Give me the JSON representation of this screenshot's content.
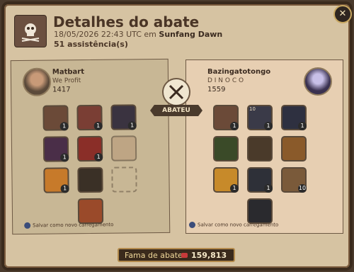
{
  "header": {
    "title": "Detalhes do abate",
    "datetime": "18/05/2026 22:43 UTC em",
    "zone": "Sunfang Dawn",
    "assists_count": "51",
    "assists_label": "assistência(s)"
  },
  "killer": {
    "name": "Matbart",
    "guild": "We Profit",
    "item_power": "1417",
    "slots": [
      {
        "slot": "bag",
        "quality": "1",
        "level": ""
      },
      {
        "slot": "head",
        "quality": "1",
        "level": ""
      },
      {
        "slot": "cape",
        "quality": "1",
        "level": ""
      },
      {
        "slot": "main-hand",
        "quality": "1",
        "level": ""
      },
      {
        "slot": "armor",
        "quality": "1",
        "level": ""
      },
      {
        "slot": "off-hand",
        "quality": "",
        "level": ""
      },
      {
        "slot": "food",
        "quality": "1",
        "level": ""
      },
      {
        "slot": "shoes",
        "quality": "",
        "level": ""
      },
      {
        "slot": "mount",
        "quality": "",
        "level": ""
      }
    ],
    "save_label": "Salvar como novo carregamento"
  },
  "victim": {
    "name": "Bazingatotongo",
    "guild": "D I N O C O",
    "item_power": "1559",
    "slots": [
      {
        "slot": "bag",
        "quality": "1",
        "level": ""
      },
      {
        "slot": "head",
        "quality": "1",
        "level": "10"
      },
      {
        "slot": "cape",
        "quality": "1",
        "level": ""
      },
      {
        "slot": "main-hand",
        "quality": "",
        "level": ""
      },
      {
        "slot": "armor",
        "quality": "",
        "level": ""
      },
      {
        "slot": "off-hand",
        "quality": "",
        "level": ""
      },
      {
        "slot": "food",
        "quality": "1",
        "level": ""
      },
      {
        "slot": "shoes",
        "quality": "1",
        "level": ""
      },
      {
        "slot": "potion",
        "quality": "10",
        "level": ""
      },
      {
        "slot": "mount",
        "quality": "",
        "level": ""
      }
    ],
    "save_label": "Salvar como novo carregamento"
  },
  "center": {
    "abateu_label": "ABATEU"
  },
  "fame": {
    "label": "Fama de abate",
    "value": "159,813"
  },
  "colors": {
    "panel": "#d6c3a2",
    "accent_gold": "#b28a4c",
    "dark": "#3a2a1c"
  },
  "icons": {
    "close": "close-icon",
    "skull": "skull-icon",
    "swords": "crossed-swords-icon",
    "fame": "fame-icon",
    "load": "loadout-icon"
  }
}
